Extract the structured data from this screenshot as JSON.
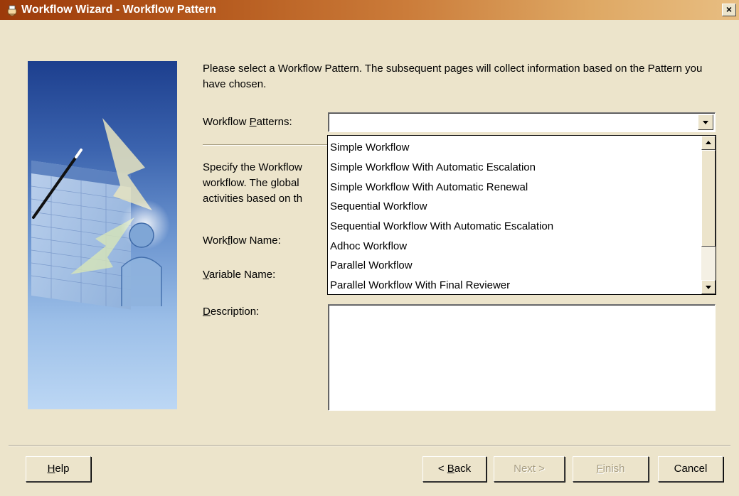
{
  "window": {
    "title": "Workflow Wizard - Workflow Pattern",
    "close_glyph": "×"
  },
  "intro": {
    "text": "Please select a Workflow Pattern. The subsequent pages will collect information based on the Pattern you have chosen."
  },
  "patterns": {
    "label_pre": "Workflow ",
    "label_key": "P",
    "label_post": "atterns:",
    "selected_value": "",
    "options": [
      "Simple Workflow",
      "Simple Workflow With Automatic Escalation",
      "Simple Workflow With Automatic Renewal",
      "Sequential Workflow",
      "Sequential Workflow With Automatic Escalation",
      "Adhoc Workflow",
      "Parallel Workflow",
      "Parallel Workflow With Final Reviewer"
    ]
  },
  "spec": {
    "line1": "Specify the Workflow",
    "line2": "workflow. The global",
    "line3": "activities based on th"
  },
  "fields": {
    "workflow_name_pre": "Work",
    "workflow_name_key": "f",
    "workflow_name_post": "low Name:",
    "variable_name_key": "V",
    "variable_name_post": "ariable Name:",
    "description_key": "D",
    "description_post": "escription:",
    "description_value": ""
  },
  "buttons": {
    "help_key": "H",
    "help_post": "elp",
    "back_pre": "< ",
    "back_key": "B",
    "back_post": "ack",
    "next_label": "Next >",
    "finish_key": "F",
    "finish_post": "inish",
    "cancel_label": "Cancel"
  },
  "colors": {
    "dialog_bg": "#ECE4CB",
    "titlebar_start": "#9C3A0A",
    "titlebar_end": "#E8BE82",
    "disabled_text": "#A89E82"
  },
  "icons": {
    "title": "wizard-app-icon",
    "side": "wizard-illustration",
    "combo": "chevron-down-icon"
  }
}
